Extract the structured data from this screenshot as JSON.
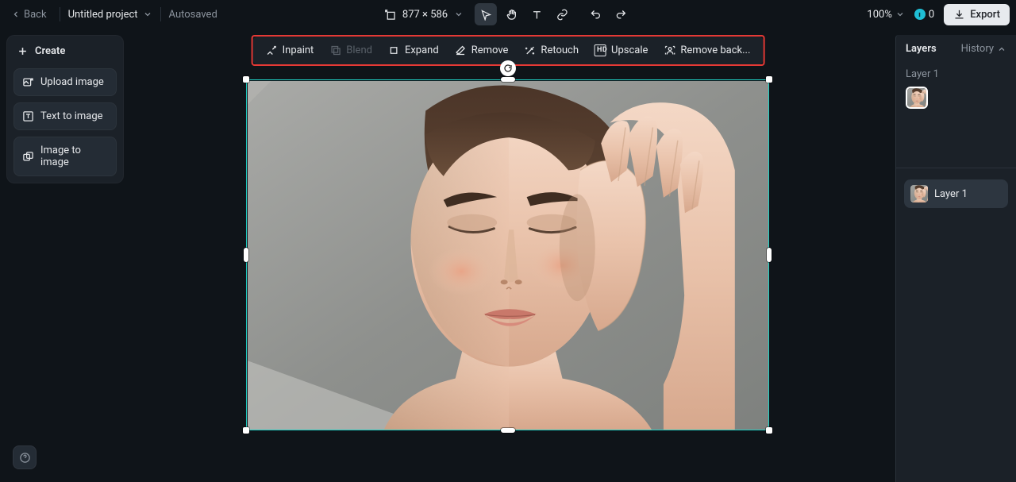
{
  "header": {
    "back_label": "Back",
    "project_name": "Untitled project",
    "autosave_label": "Autosaved",
    "dimensions_text": "877 × 586",
    "zoom_text": "100%",
    "credits_value": "0",
    "export_label": "Export"
  },
  "left_panel": {
    "title": "Create",
    "items": [
      {
        "id": "upload-image",
        "label": "Upload image"
      },
      {
        "id": "text-to-image",
        "label": "Text to image"
      },
      {
        "id": "image-to-image",
        "label": "Image to image"
      }
    ]
  },
  "actions": {
    "inpaint": "Inpaint",
    "blend": "Blend",
    "expand": "Expand",
    "remove": "Remove",
    "retouch": "Retouch",
    "upscale": "Upscale",
    "remove_bg": "Remove back..."
  },
  "right_panel": {
    "title": "Layers",
    "history_label": "History",
    "current_layer_label": "Layer 1",
    "layer_item_label": "Layer 1"
  },
  "icons": {
    "chevron_left": "chevron-left",
    "chevron_down": "chevron-down",
    "chevron_up": "chevron-up",
    "dims": "crop-dims",
    "select": "cursor",
    "hand": "hand",
    "text": "text",
    "link": "link",
    "undo": "undo",
    "redo": "redo",
    "download": "download",
    "plus": "plus",
    "upload": "upload-image",
    "t2i": "text-to-image",
    "i2i": "image-to-image",
    "inpaint": "inpaint",
    "blend": "blend",
    "expand": "expand",
    "remove": "remove",
    "retouch": "retouch",
    "hd": "hd",
    "remove_bg": "remove-bg",
    "refresh": "refresh",
    "help": "help"
  }
}
